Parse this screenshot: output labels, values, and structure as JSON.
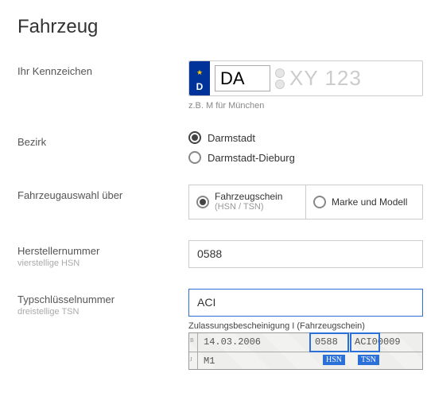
{
  "title": "Fahrzeug",
  "plate": {
    "label": "Ihr Kennzeichen",
    "country": "D",
    "district_value": "DA",
    "rest_placeholder": "XY 123",
    "hint": "z.B. M für München"
  },
  "bezirk": {
    "label": "Bezirk",
    "options": [
      "Darmstadt",
      "Darmstadt-Dieburg"
    ],
    "selected": 0
  },
  "fahrzeugauswahl": {
    "label": "Fahrzeugauswahl über",
    "options": [
      {
        "title": "Fahrzeugschein",
        "sub": "(HSN / TSN)"
      },
      {
        "title": "Marke und Modell",
        "sub": ""
      }
    ],
    "selected": 0
  },
  "hsn": {
    "label": "Herstellernummer",
    "sub": "vierstellige HSN",
    "value": "0588"
  },
  "tsn": {
    "label": "Typschlüsselnummer",
    "sub": "dreistellige TSN",
    "value": "ACI"
  },
  "cert": {
    "title_bold": "Zulassungsbescheinigung I",
    "title_rest": " (Fahrzeugschein)",
    "date": "14.03.2006",
    "hsn": "0588",
    "tsn_full": "ACI00009",
    "m1": "M1",
    "tag_hsn": "HSN",
    "tag_tsn": "TSN"
  }
}
